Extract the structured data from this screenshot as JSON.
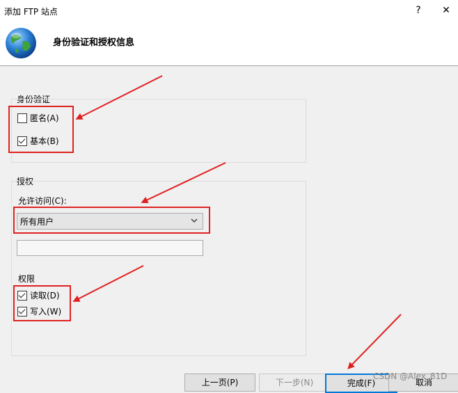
{
  "window": {
    "title": "添加 FTP 站点",
    "help_label": "?",
    "close_label": "✕"
  },
  "header": {
    "icon": "globe-icon",
    "title": "身份验证和授权信息"
  },
  "authentication": {
    "group_label": "身份验证",
    "anonymous": {
      "label": "匿名(A)",
      "checked": false
    },
    "basic": {
      "label": "基本(B)",
      "checked": true
    }
  },
  "authorization": {
    "group_label": "授权",
    "allow_access_label": "允许访问(C):",
    "allow_access_value": "所有用户",
    "extra_input_value": ""
  },
  "permissions": {
    "group_label": "权限",
    "read": {
      "label": "读取(D)",
      "checked": true
    },
    "write": {
      "label": "写入(W)",
      "checked": true
    }
  },
  "footer": {
    "prev_label": "上一页(P)",
    "next_label": "下一步(N)",
    "finish_label": "完成(F)",
    "cancel_label": "取消"
  },
  "watermark": "CSDN @Alex_81D",
  "colors": {
    "annotation_red": "#e02020",
    "focus_blue": "#0078d7"
  }
}
